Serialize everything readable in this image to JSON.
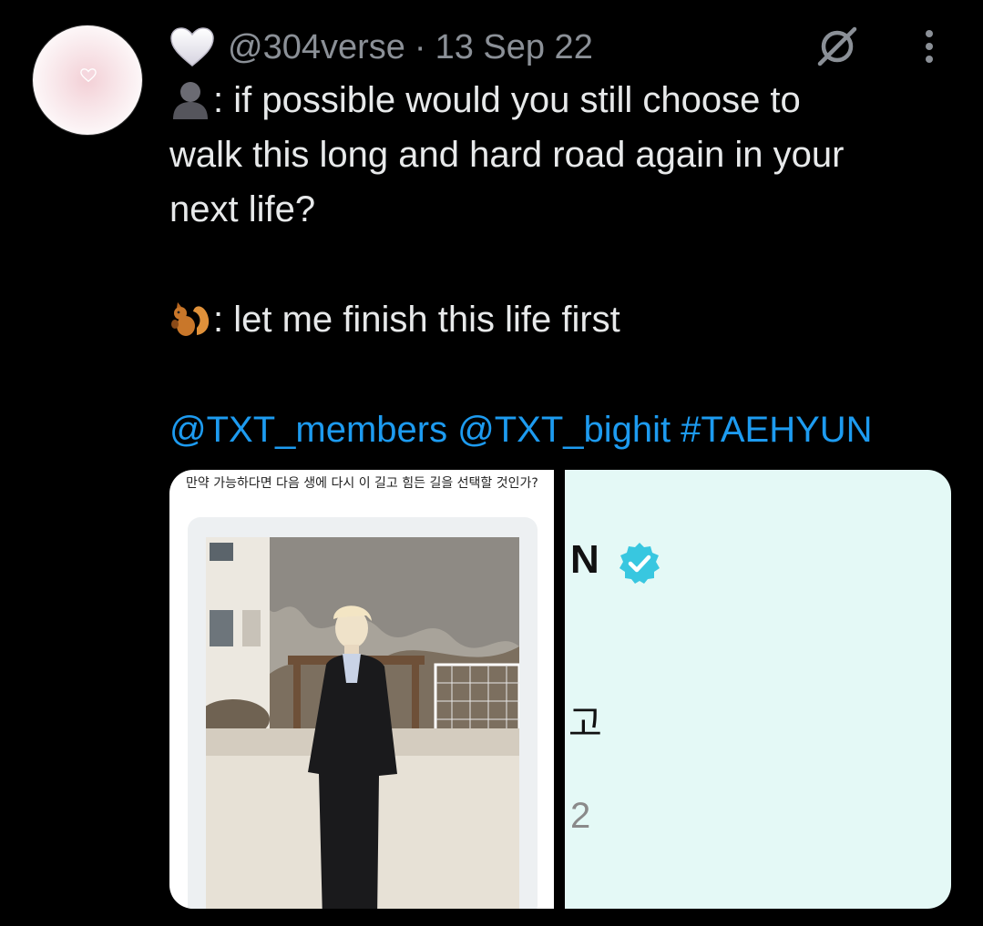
{
  "tweet": {
    "handle": "@304verse",
    "separator": "·",
    "date": "13 Sep 22",
    "lines": [
      ": if possible would you still choose to",
      "walk this long and hard road again in your",
      "next life?",
      ": let me finish this life first"
    ],
    "mentions": [
      "@TXT_members",
      "@TXT_bighit",
      "#TAEHYUN"
    ]
  },
  "icons": {
    "name_emoji": "white-heart-icon",
    "speaker1_emoji": "silhouette-icon",
    "speaker2_emoji": "squirrel-icon",
    "mute": "mute-icon",
    "more": "more-vertical-icon"
  },
  "media": {
    "left_caption": "만약 가능하다면 다음 생에 다시 이 길고 힘든 길을 선택할 것인가?",
    "right_letter": "N",
    "right_char": "고",
    "right_number": "2"
  },
  "colors": {
    "background": "#000000",
    "text": "#e7e9ea",
    "muted": "#8b9097",
    "link": "#1d9bf0",
    "verified": "#38c7e0"
  }
}
